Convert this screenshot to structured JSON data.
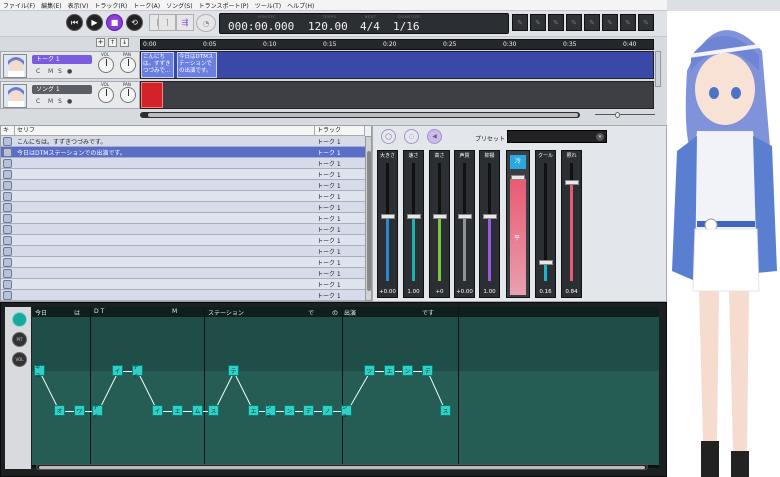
{
  "menu": [
    "ファイル(F)",
    "編集(E)",
    "表示(V)",
    "トラック(R)",
    "トーク(A)",
    "ソング(S)",
    "トランスポート(P)",
    "ツール(T)",
    "ヘルプ(H)"
  ],
  "transport": {
    "minsec_label": "MIN/SEC",
    "tempo_label": "TEMPO",
    "beat_label": "BEAT",
    "quantize_label": "QUANTIZE",
    "time": "000:00.000",
    "tempo": "120.00",
    "beat": "4/4",
    "quantize": "1/16"
  },
  "tracks": [
    {
      "name": "トーク 1",
      "mute": "C",
      "solo": "M",
      "s": "S",
      "dot": "●",
      "vol": "VOL",
      "pan": "PAN",
      "color": "#7b5be0"
    },
    {
      "name": "ソング 1",
      "mute": "C",
      "solo": "M",
      "s": "S",
      "dot": "●",
      "vol": "VOL",
      "pan": "PAN",
      "color": "#5b5e66"
    }
  ],
  "ruler": [
    "0:00",
    "0:05",
    "0:10",
    "0:15",
    "0:20",
    "0:25",
    "0:30",
    "0:35",
    "0:40"
  ],
  "clips": [
    {
      "text": "こんにちは。すずきつづみで..."
    },
    {
      "text": "今日はDTMステーションでの出演です。"
    }
  ],
  "table": {
    "headers": [
      "キャ",
      "セリフ",
      "トラック"
    ],
    "rows": [
      {
        "text": "こんにちは。すずきつづみです。",
        "track": "トーク 1"
      },
      {
        "text": "今日はDTMステーションでの出演です。",
        "track": "トーク 1"
      },
      {
        "text": "",
        "track": "トーク 1"
      },
      {
        "text": "",
        "track": "トーク 1"
      },
      {
        "text": "",
        "track": "トーク 1"
      },
      {
        "text": "",
        "track": "トーク 1"
      },
      {
        "text": "",
        "track": "トーク 1"
      },
      {
        "text": "",
        "track": "トーク 1"
      },
      {
        "text": "",
        "track": "トーク 1"
      },
      {
        "text": "",
        "track": "トーク 1"
      },
      {
        "text": "",
        "track": "トーク 1"
      },
      {
        "text": "",
        "track": "トーク 1"
      },
      {
        "text": "",
        "track": "トーク 1"
      },
      {
        "text": "",
        "track": "トーク 1"
      },
      {
        "text": "",
        "track": "トーク 1"
      }
    ]
  },
  "mixer": {
    "preset_label": "プリセット",
    "faders": [
      {
        "label": "大きさ",
        "value": "+0.00",
        "level": 0.55,
        "color": "#2b86d6"
      },
      {
        "label": "速さ",
        "value": "1.00",
        "level": 0.55,
        "color": "#18b3b0"
      },
      {
        "label": "高さ",
        "value": "+0",
        "level": 0.55,
        "color": "#7bc83a"
      },
      {
        "label": "声質",
        "value": "+0.00",
        "level": 0.55,
        "color": "#8f9398"
      },
      {
        "label": "抑揚",
        "value": "1.00",
        "level": 0.55,
        "color": "#9a5be0"
      },
      {
        "label": "クール",
        "value": "0.16",
        "level": 0.16,
        "color": "#19b6c8"
      },
      {
        "label": "照れ",
        "value": "0.84",
        "level": 0.84,
        "color": "#e85a72"
      }
    ],
    "emotion_label": "平",
    "emotion_top": "冷"
  },
  "editor": {
    "buttons": [
      "",
      "PIT",
      "VOL"
    ],
    "phrases": [
      "今日",
      "は",
      "D T",
      "M",
      "ステーション",
      "で",
      "の",
      "出演",
      "です"
    ],
    "notes": [
      {
        "t": "キョ",
        "row": 0
      },
      {
        "t": "オ",
        "row": 1
      },
      {
        "t": "ワ",
        "row": 1
      },
      {
        "t": "ディ",
        "row": 1
      },
      {
        "t": "イ",
        "row": 0
      },
      {
        "t": "ティ",
        "row": 0
      },
      {
        "t": "イ",
        "row": 1
      },
      {
        "t": "エ",
        "row": 1
      },
      {
        "t": "ム",
        "row": 1
      },
      {
        "t": "ス",
        "row": 1
      },
      {
        "t": "テ",
        "row": 0
      },
      {
        "t": "エ",
        "row": 1
      },
      {
        "t": "ショ",
        "row": 1
      },
      {
        "t": "ン",
        "row": 1
      },
      {
        "t": "デ",
        "row": 1
      },
      {
        "t": "ノ",
        "row": 1
      },
      {
        "t": "シュ",
        "row": 1
      },
      {
        "t": "ツ",
        "row": 0
      },
      {
        "t": "エ",
        "row": 0
      },
      {
        "t": "ン",
        "row": 0
      },
      {
        "t": "デ",
        "row": 0
      },
      {
        "t": "ス",
        "row": 1
      }
    ]
  }
}
